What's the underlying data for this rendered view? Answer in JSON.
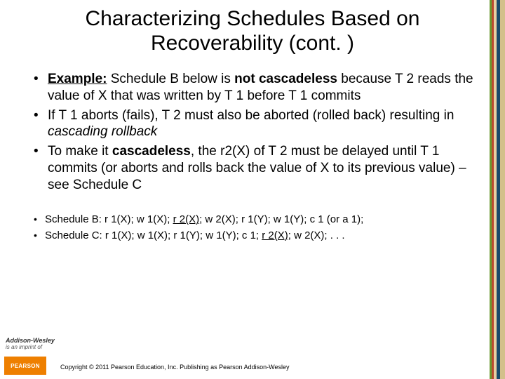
{
  "title": "Characterizing Schedules Based on Recoverability (cont. )",
  "bullets_big_html": [
    "<span class='b u'>Example:</span> Schedule B below is <span class='b'>not cascadeless</span> because T 2 reads the value of X that was written by T 1 before T 1 commits",
    "If T 1 aborts (fails), T 2 must also be aborted (rolled back) resulting in <span class='i'>cascading rollback</span>",
    "To make it <span class='b'>cascadeless</span>, the r2(X) of T 2 must be delayed until T 1 commits (or aborts and rolls back the value of X to its previous value) – see Schedule C"
  ],
  "bullets_small_html": [
    "Schedule B: r 1(X); w 1(X); <span class='u'>r 2(X)</span>; w 2(X); r 1(Y); w 1(Y); c 1 (or a 1);",
    "Schedule C: r 1(X); w 1(X); r 1(Y); w 1(Y); c 1; <span class='u'>r 2(X)</span>; w 2(X); . . ."
  ],
  "footer": {
    "imprint_brand": "Addison-Wesley",
    "imprint_line": "is an imprint of",
    "pearson_label": "PEARSON",
    "copyright": "Copyright © 2011 Pearson Education, Inc. Publishing as Pearson Addison-Wesley"
  }
}
